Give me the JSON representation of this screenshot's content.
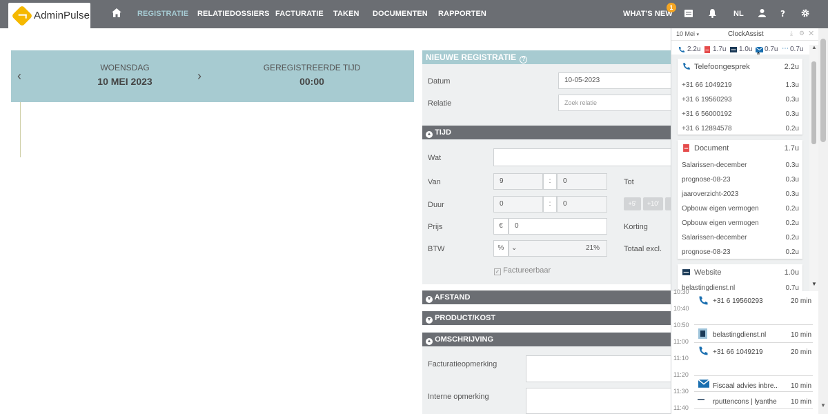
{
  "app": {
    "name": "AdminPulse"
  },
  "nav": {
    "items": [
      {
        "label": "REGISTRATIE"
      },
      {
        "label": "RELATIEDOSSIERS"
      },
      {
        "label": "FACTURATIE"
      },
      {
        "label": "TAKEN"
      },
      {
        "label": "DOCUMENTEN"
      },
      {
        "label": "RAPPORTEN"
      }
    ],
    "whats_new": "WHAT'S NEW",
    "whats_new_badge": "1",
    "language": "NL",
    "icons": [
      "home-icon",
      "list-icon",
      "bell-icon",
      "user-icon",
      "help-icon",
      "gear-icon"
    ]
  },
  "datepanel": {
    "day": "WOENSDAG",
    "date": "10 MEI 2023",
    "reg_label": "GEREGISTREERDE TIJD",
    "reg_value": "00:00"
  },
  "form": {
    "title": "NIEUWE REGISTRATIE",
    "datum_label": "Datum",
    "datum_value": "10-05-2023",
    "relatie_label": "Relatie",
    "relatie_placeholder": "Zoek relatie",
    "tijd_header": "TIJD",
    "wat_label": "Wat",
    "van_label": "Van",
    "van_h": "9",
    "van_m": "0",
    "colon": ":",
    "tot_label": "Tot",
    "duur_label": "Duur",
    "duur_h": "0",
    "duur_m": "0",
    "plus5": "+5'",
    "plus10": "+10'",
    "prijs_label": "Prijs",
    "currency": "€",
    "prijs_value": "0",
    "korting_label": "Korting",
    "btw_label": "BTW",
    "btw_pct": "%",
    "btw_value": "21%",
    "totaal_label": "Totaal excl.",
    "factureerbaar": "Factureerbaar",
    "afstand_header": "AFSTAND",
    "product_header": "PRODUCT/KOST",
    "omschrijving_header": "OMSCHRIJVING",
    "facturatie_label": "Facturatieopmerking",
    "intern_label": "Interne opmerking"
  },
  "clockassist": {
    "date": "10 Mei",
    "title": "ClockAssist",
    "summary": [
      {
        "icon": "phone-icon",
        "value": "2.2u"
      },
      {
        "icon": "pdf-icon",
        "value": "1.7u"
      },
      {
        "icon": "website-icon",
        "value": "1.0u"
      },
      {
        "icon": "mail-icon",
        "value": "0.7u"
      },
      {
        "icon": "dash-icon",
        "value": "0.7u"
      }
    ],
    "groups": [
      {
        "title": "Telefoongesprek",
        "total": "2.2u",
        "items": [
          {
            "label": "+31 66 1049219",
            "value": "1.3u"
          },
          {
            "label": "+31 6 19560293",
            "value": "0.3u"
          },
          {
            "label": "+31 6 56000192",
            "value": "0.3u"
          },
          {
            "label": "+31 6 12894578",
            "value": "0.2u"
          }
        ]
      },
      {
        "title": "Document",
        "total": "1.7u",
        "items": [
          {
            "label": "Salarissen-december",
            "value": "0.3u"
          },
          {
            "label": "prognose-08-23",
            "value": "0.3u"
          },
          {
            "label": "jaaroverzicht-2023",
            "value": "0.3u"
          },
          {
            "label": "Opbouw eigen vermogen",
            "value": "0.2u"
          },
          {
            "label": "Opbouw eigen vermogen",
            "value": "0.2u"
          },
          {
            "label": "Salarissen-december",
            "value": "0.2u"
          },
          {
            "label": "prognose-08-23",
            "value": "0.2u"
          }
        ]
      },
      {
        "title": "Website",
        "total": "1.0u",
        "items": [
          {
            "label": "belastingdienst.nl",
            "value": "0.7u"
          }
        ]
      }
    ],
    "times": [
      "10:30",
      "10:40",
      "10:50",
      "11:00",
      "11:10",
      "11:20",
      "11:30",
      "11:40"
    ],
    "timeline": [
      {
        "icon": "phone-icon",
        "label": "+31 6 19560293",
        "duration": "20 min"
      },
      {
        "icon": "document-icon",
        "label": "belastingdienst.nl",
        "duration": "10 min"
      },
      {
        "icon": "phone-icon",
        "label": "+31 66 1049219",
        "duration": "20 min"
      },
      {
        "icon": "mail-icon",
        "label": "Fiscaal advies inbre...",
        "duration": "10 min"
      },
      {
        "icon": "website-icon",
        "label": "rputtencons | lyanthe",
        "duration": "10 min"
      }
    ]
  },
  "colors": {
    "nav": "#6b6e73",
    "nav_active": "#a6cbd3",
    "date_panel": "#a7cbd1",
    "accent": "#1a6fb0",
    "badge": "#f5a623"
  }
}
